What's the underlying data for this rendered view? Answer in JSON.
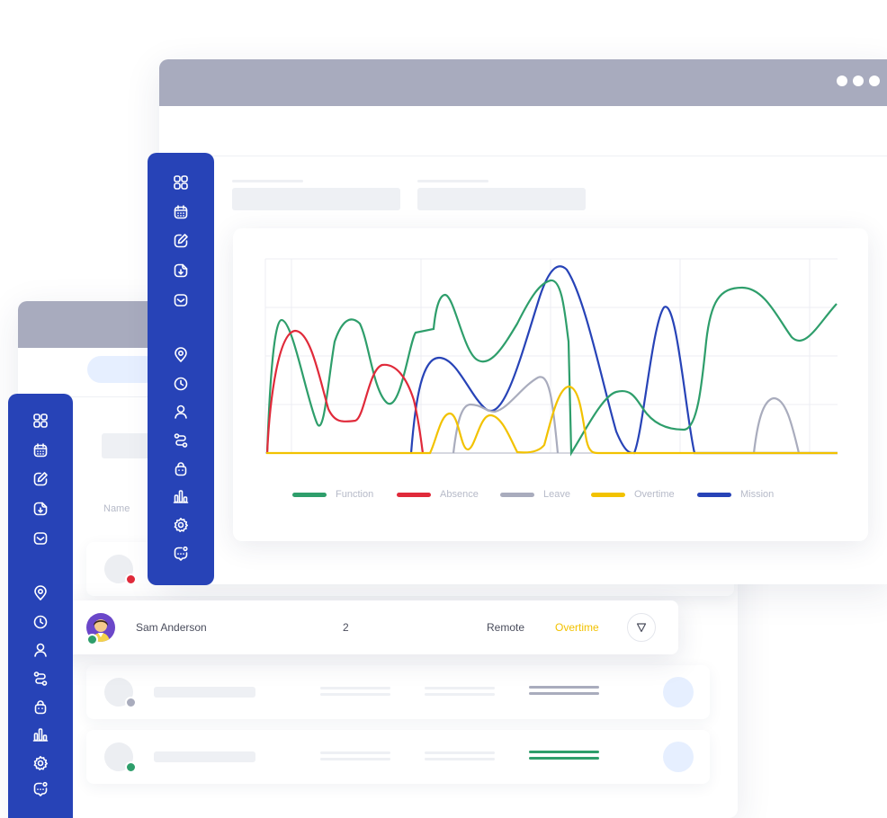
{
  "legend": [
    {
      "label": "Function",
      "color": "#2e9e6b"
    },
    {
      "label": "Absence",
      "color": "#e02a3a"
    },
    {
      "label": "Leave",
      "color": "#a9acbd"
    },
    {
      "label": "Overtime",
      "color": "#f2c200"
    },
    {
      "label": "Mission",
      "color": "#2743b7"
    }
  ],
  "table": {
    "name_header": "Name"
  },
  "employee_row": {
    "name": "Sam Anderson",
    "count": "2",
    "location": "Remote",
    "status": "Overtime",
    "status_color": "#f2c200"
  },
  "status_colors": {
    "red": "#e02a3a",
    "gray": "#a9acbd",
    "green": "#2e9e6b"
  },
  "sidebar_icons": [
    "grid-icon",
    "calendar-icon",
    "edit-icon",
    "download-doc-icon",
    "inbox-icon",
    "location-icon",
    "clock-icon",
    "user-icon",
    "route-icon",
    "bag-icon",
    "bar-chart-icon",
    "settings-icon",
    "chat-icon"
  ]
}
